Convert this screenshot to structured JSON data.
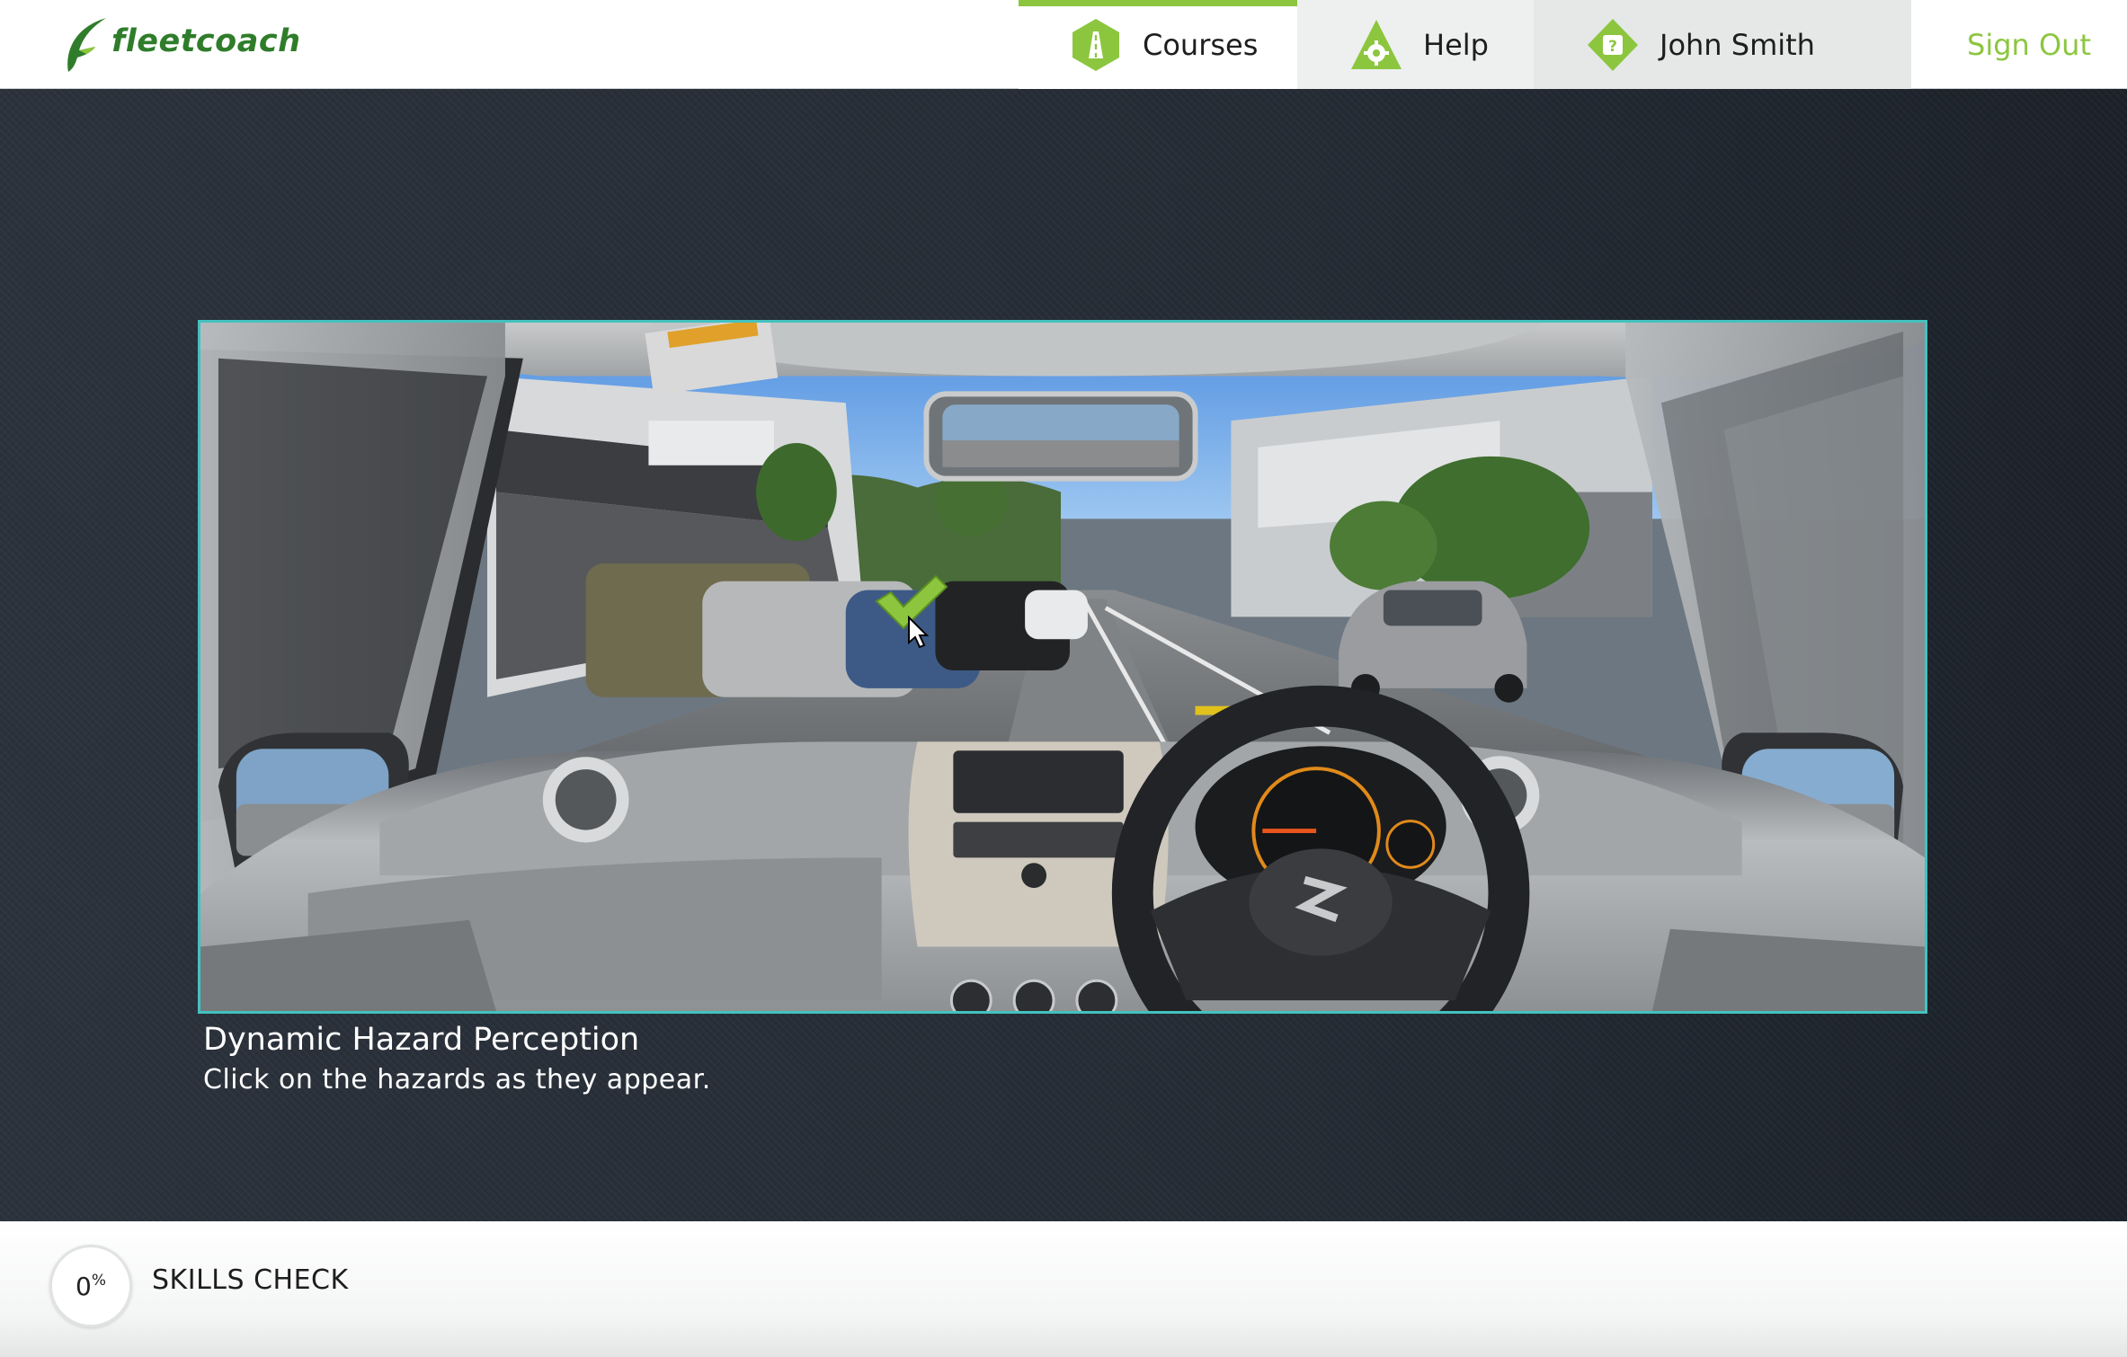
{
  "brand": {
    "name": "fleetcoach",
    "color": "#2f7d2a"
  },
  "nav": {
    "courses_label": "Courses",
    "help_label": "Help",
    "user_label": "John Smith",
    "sign_out_label": "Sign Out",
    "active_tab": "Courses",
    "accent_color": "#8cc63f"
  },
  "activity": {
    "title": "Dynamic Hazard Perception",
    "instruction": "Click on the hazards as they appear.",
    "frame_color": "#43c2bf",
    "hazard_marker": "checkmark-icon"
  },
  "footer": {
    "progress_value": "0",
    "progress_unit": "%",
    "module_title": "SKILLS CHECK"
  },
  "icons": {
    "courses": "road-sign-icon",
    "help": "gear-icon",
    "user": "question-icon"
  }
}
